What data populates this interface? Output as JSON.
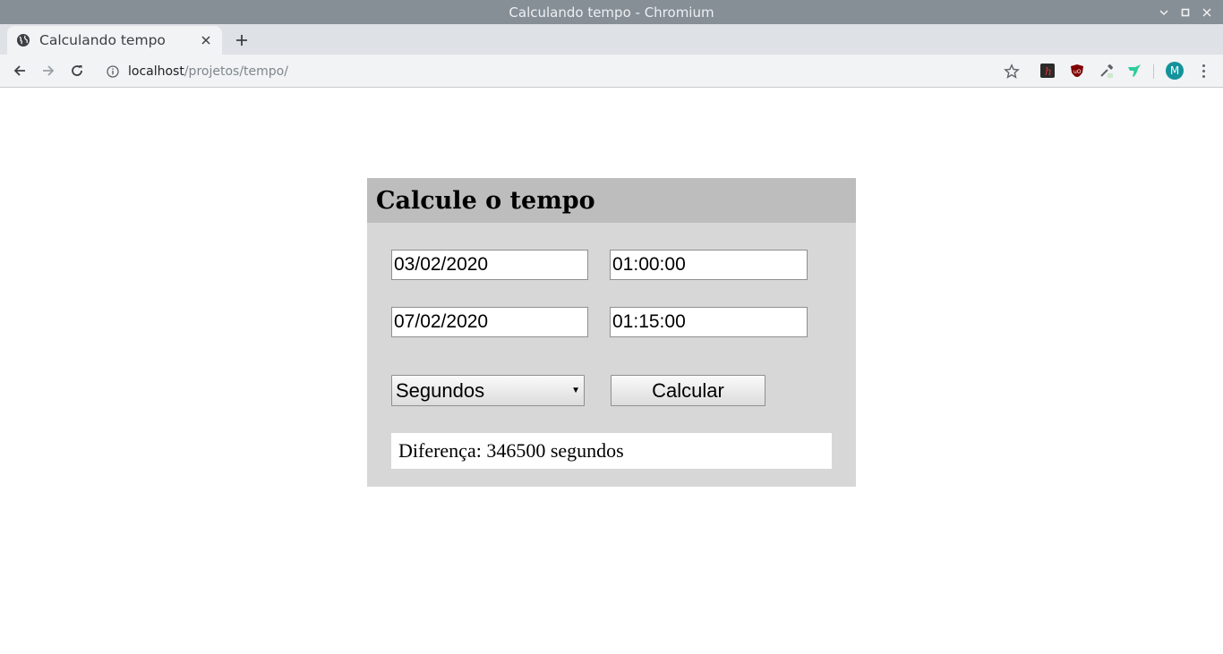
{
  "window": {
    "title": "Calculando tempo - Chromium"
  },
  "tab": {
    "title": "Calculando tempo",
    "favicon": "globe-icon"
  },
  "toolbar": {
    "url_host": "localhost",
    "url_path": "/projetos/tempo/",
    "avatar_letter": "M",
    "extensions": [
      "h-extension-icon",
      "ublock-icon",
      "eyedropper-icon",
      "bird-extension-icon"
    ]
  },
  "page": {
    "heading": "Calcule o tempo",
    "start_date": "03/02/2020",
    "start_time": "01:00:00",
    "end_date": "07/02/2020",
    "end_time": "01:15:00",
    "unit_selected": "Segundos",
    "calc_button": "Calcular",
    "result": "Diferença: 346500 segundos"
  },
  "colors": {
    "titlebar": "#868e96",
    "card_bg": "#d7d7d7",
    "card_header": "#bdbdbd",
    "avatar": "#14939b"
  }
}
